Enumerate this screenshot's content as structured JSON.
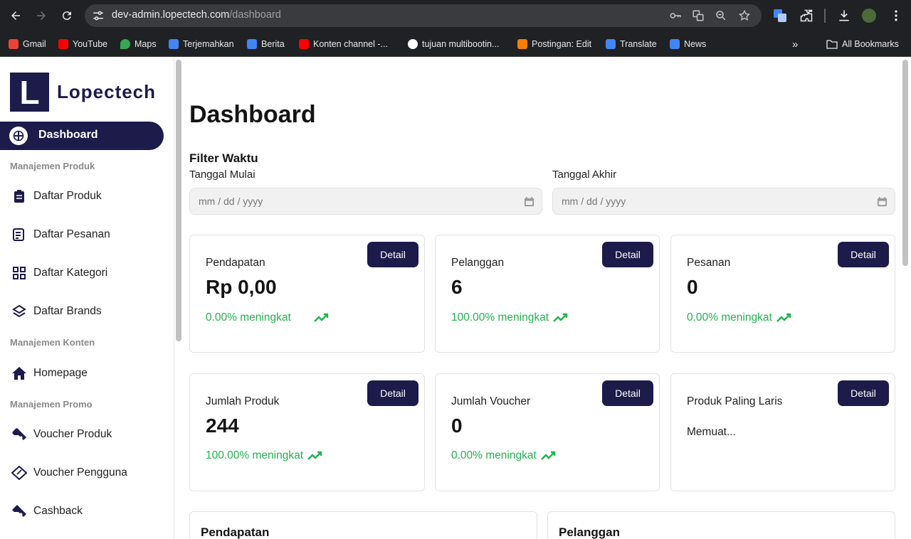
{
  "browser": {
    "url_host": "dev-admin.lopectech.com",
    "url_path": "/dashboard",
    "bookmarks": [
      {
        "label": "Gmail",
        "icon": "gmail-icon",
        "color": "#ea4335"
      },
      {
        "label": "YouTube",
        "icon": "youtube-icon",
        "color": "#ff0000"
      },
      {
        "label": "Maps",
        "icon": "maps-icon",
        "color": "#34a853"
      },
      {
        "label": "Terjemahkan",
        "icon": "translate-icon",
        "color": "#4285f4"
      },
      {
        "label": "Berita",
        "icon": "news-icon",
        "color": "#4285f4"
      },
      {
        "label": "Konten channel -...",
        "icon": "youtube-icon",
        "color": "#ff0000"
      },
      {
        "label": "tujuan multibootin...",
        "icon": "google-icon",
        "color": "#ffffff"
      },
      {
        "label": "Postingan: Edit",
        "icon": "blogger-icon",
        "color": "#f57d00"
      },
      {
        "label": "Translate",
        "icon": "translate-icon",
        "color": "#4285f4"
      },
      {
        "label": "News",
        "icon": "news-icon",
        "color": "#4285f4"
      }
    ],
    "all_bookmarks": "All Bookmarks"
  },
  "sidebar": {
    "logo_letter": "L",
    "brand": "Lopectech",
    "active": "Dashboard",
    "sections": [
      {
        "title": "Manajemen Produk"
      },
      {
        "title": "Manajemen Konten"
      },
      {
        "title": "Manajemen Promo"
      }
    ],
    "items": [
      {
        "label": "Daftar Produk",
        "icon": "clipboard-icon"
      },
      {
        "label": "Daftar Pesanan",
        "icon": "receipt-icon"
      },
      {
        "label": "Daftar Kategori",
        "icon": "grid-icon"
      },
      {
        "label": "Daftar Brands",
        "icon": "layers-icon"
      },
      {
        "label": "Homepage",
        "icon": "home-icon"
      },
      {
        "label": "Voucher Produk",
        "icon": "ticket-icon"
      },
      {
        "label": "Voucher Pengguna",
        "icon": "discount-ticket-icon"
      },
      {
        "label": "Cashback",
        "icon": "ticket-icon"
      }
    ]
  },
  "main": {
    "title": "Dashboard",
    "filter_title": "Filter Waktu",
    "start_label": "Tanggal Mulai",
    "end_label": "Tanggal Akhir",
    "date_placeholder": "mm / dd / yyyy",
    "detail_label": "Detail",
    "cards": [
      {
        "title": "Pendapatan",
        "value": "Rp 0,00",
        "trend": "0.00% meningkat"
      },
      {
        "title": "Pelanggan",
        "value": "6",
        "trend": "100.00% meningkat"
      },
      {
        "title": "Pesanan",
        "value": "0",
        "trend": "0.00% meningkat"
      },
      {
        "title": "Jumlah Produk",
        "value": "244",
        "trend": "100.00% meningkat"
      },
      {
        "title": "Jumlah Voucher",
        "value": "0",
        "trend": "0.00% meningkat"
      },
      {
        "title": "Produk Paling Laris",
        "value": "",
        "trend": "",
        "loading": "Memuat..."
      }
    ],
    "bottom_cards": [
      {
        "title": "Pendapatan"
      },
      {
        "title": "Pelanggan"
      }
    ]
  },
  "colors": {
    "primary": "#1d1b4a",
    "success": "#22b34f"
  }
}
